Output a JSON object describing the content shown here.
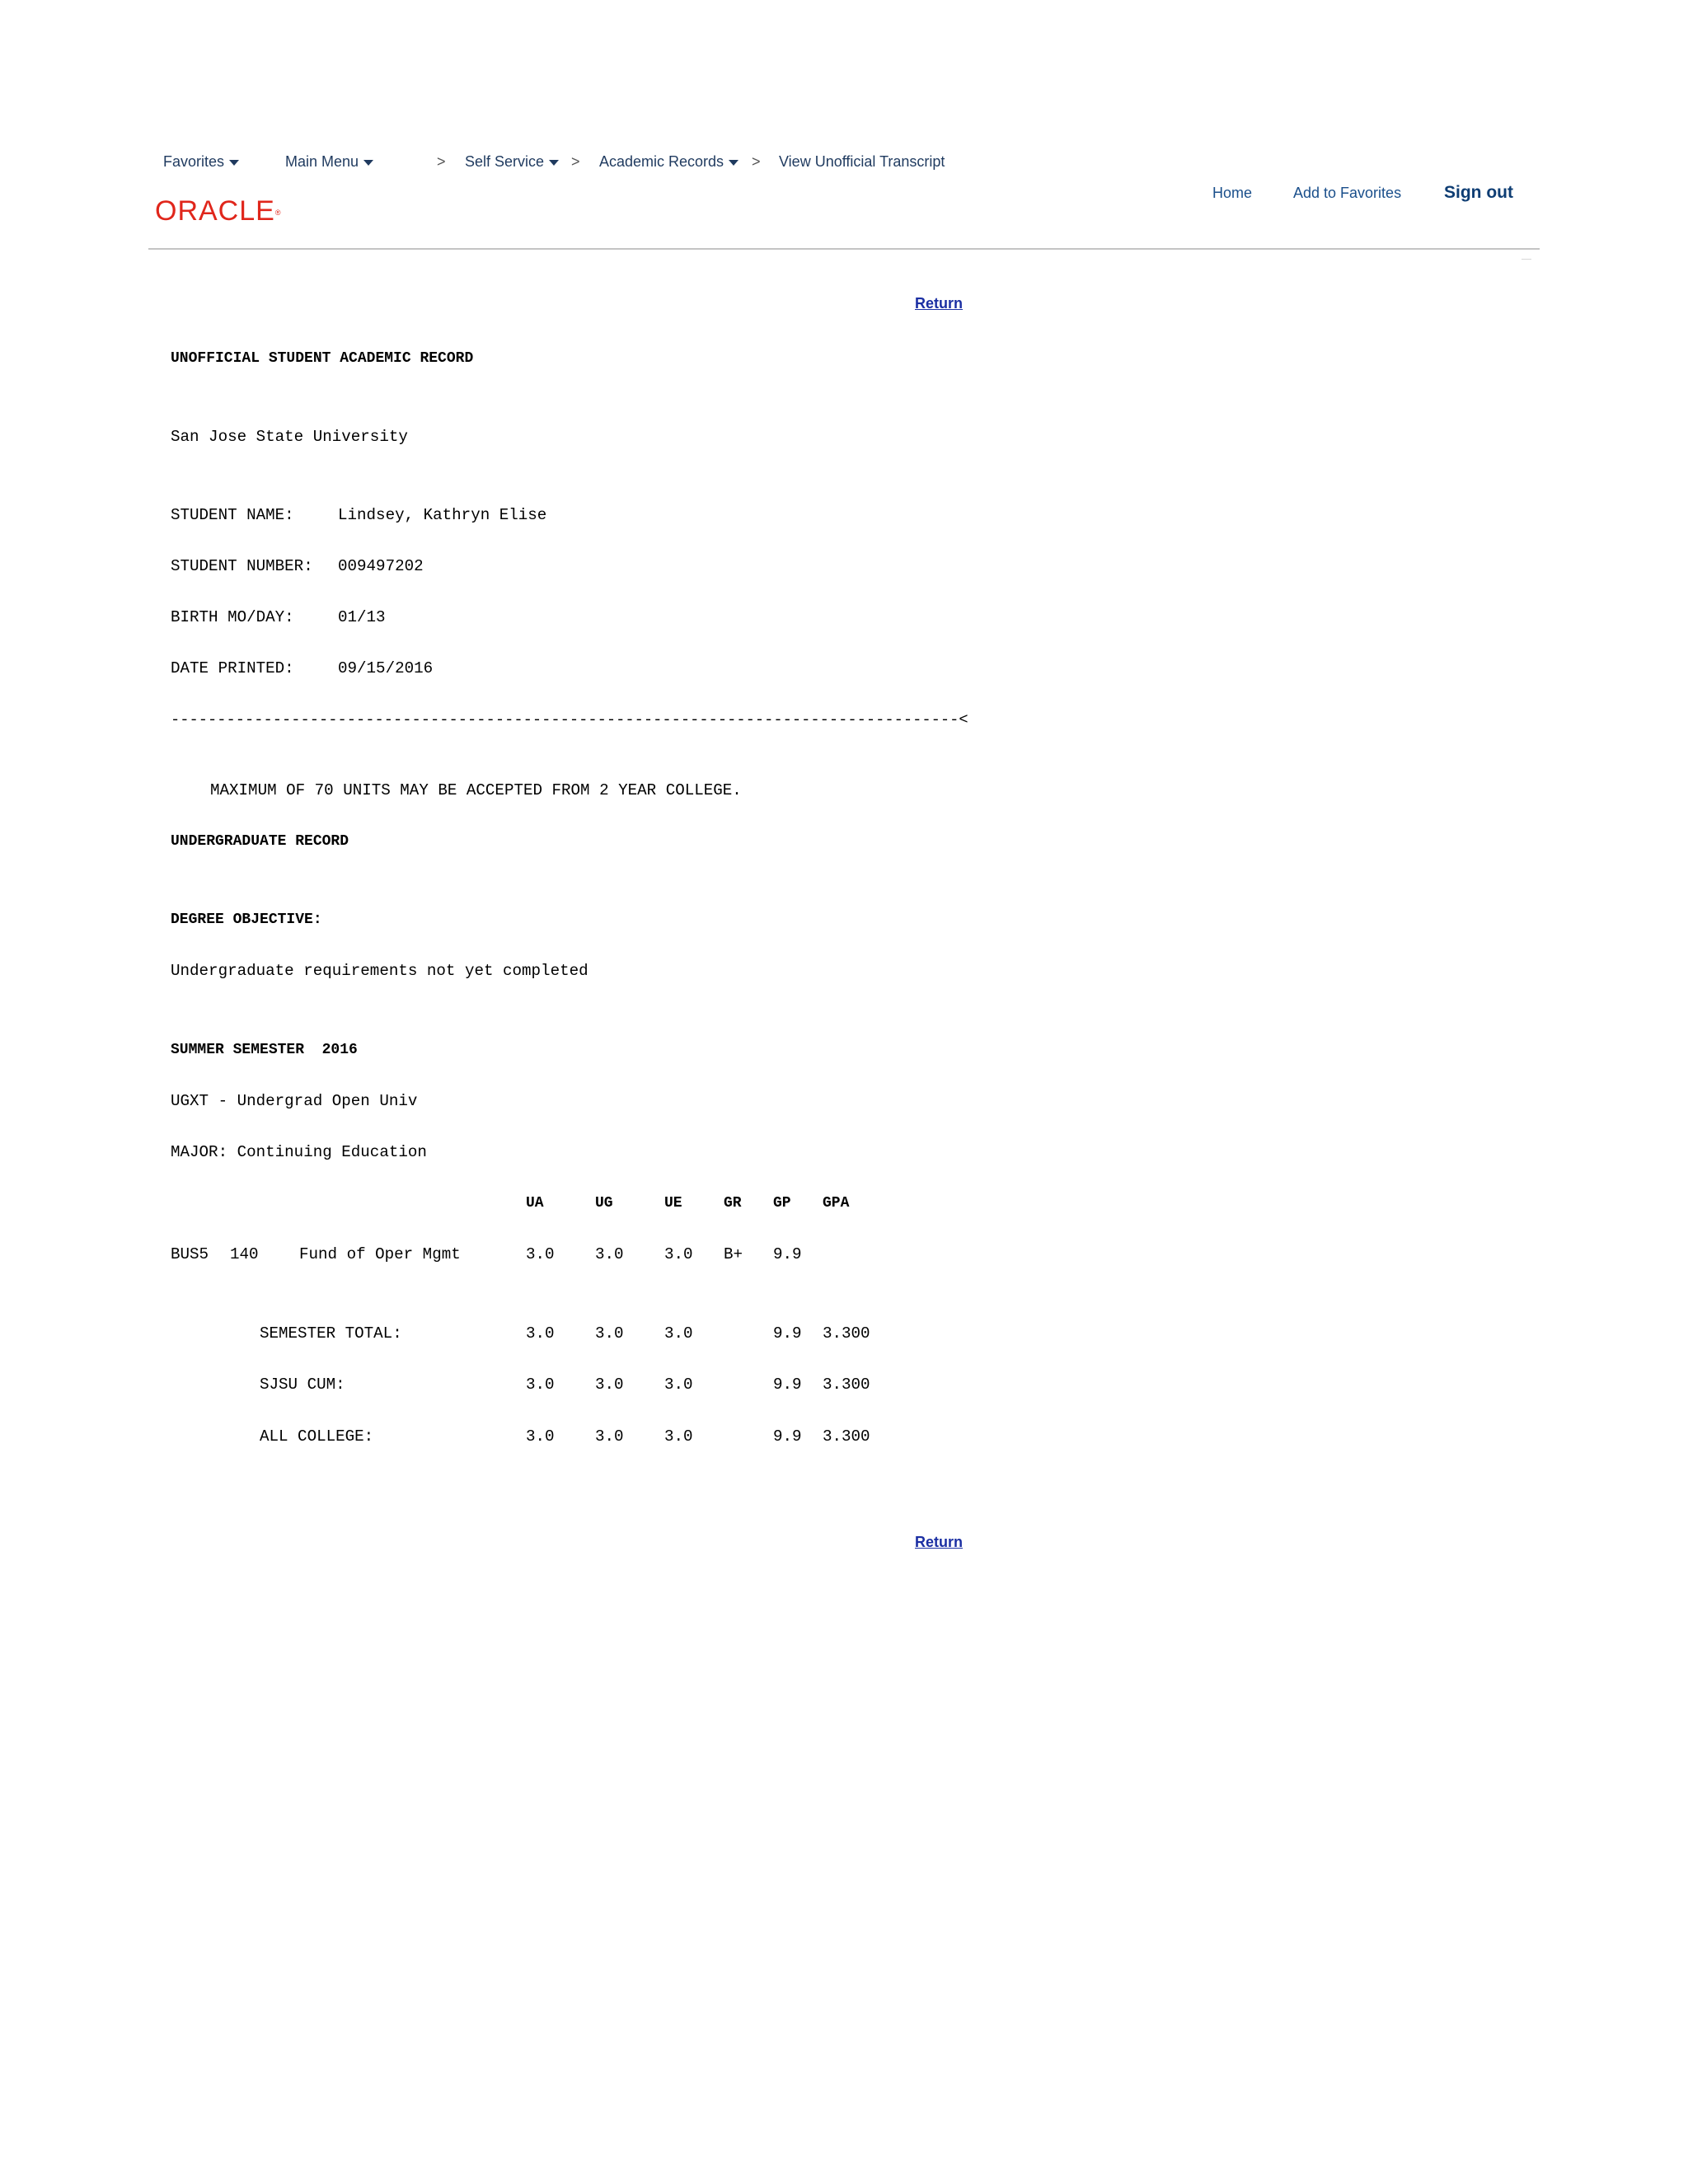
{
  "nav": {
    "favorites": "Favorites",
    "main_menu": "Main Menu",
    "self_service": "Self Service",
    "academic_records": "Academic Records",
    "current_page": "View Unofficial Transcript",
    "separator": ">"
  },
  "brand": {
    "logo_text": "ORACLE",
    "logo_mark": "®",
    "logo_color": "#e0261b"
  },
  "header_links": {
    "home": "Home",
    "add_to_favorites": "Add to Favorites",
    "sign_out": "Sign out"
  },
  "return_label": "Return",
  "record": {
    "title": "UNOFFICIAL STUDENT ACADEMIC RECORD",
    "institution": "San Jose State University",
    "fields": [
      {
        "label": "STUDENT NAME:",
        "value": "Lindsey, Kathryn Elise"
      },
      {
        "label": "STUDENT NUMBER:",
        "value": "009497202"
      },
      {
        "label": "BIRTH MO/DAY:",
        "value": "01/13"
      },
      {
        "label": "DATE PRINTED:",
        "value": "09/15/2016"
      }
    ],
    "divider": "-------------------------------------------------------------------------------------<",
    "notice": "MAXIMUM OF 70 UNITS MAY BE ACCEPTED FROM 2 YEAR COLLEGE.",
    "section_heading": "UNDERGRADUATE RECORD",
    "degree_objective_label": "DEGREE OBJECTIVE:",
    "degree_objective_value": "Undergraduate requirements not yet completed",
    "term_heading": "SUMMER SEMESTER  2016",
    "program": "UGXT - Undergrad Open Univ",
    "major": "MAJOR: Continuing Education",
    "columns": [
      "UA",
      "UG",
      "UE",
      "GR",
      "GP",
      "GPA"
    ],
    "courses": [
      {
        "subject": "BUS5",
        "number": "140",
        "title": "Fund of Oper Mgmt",
        "ua": "3.0",
        "ug": "3.0",
        "ue": "3.0",
        "gr": "B+",
        "gp": "9.9",
        "gpa": ""
      }
    ],
    "totals": [
      {
        "label": "SEMESTER TOTAL:",
        "ua": "3.0",
        "ug": "3.0",
        "ue": "3.0",
        "gp": "9.9",
        "gpa": "3.300"
      },
      {
        "label": "SJSU CUM:",
        "ua": "3.0",
        "ug": "3.0",
        "ue": "3.0",
        "gp": "9.9",
        "gpa": "3.300"
      },
      {
        "label": "ALL COLLEGE:",
        "ua": "3.0",
        "ug": "3.0",
        "ue": "3.0",
        "gp": "9.9",
        "gpa": "3.300"
      }
    ]
  }
}
